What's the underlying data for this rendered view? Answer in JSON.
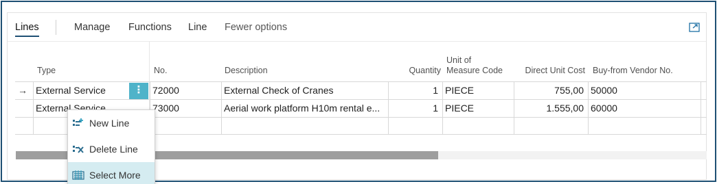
{
  "toolbar": {
    "lines": "Lines",
    "manage": "Manage",
    "functions": "Functions",
    "line": "Line",
    "fewer_options": "Fewer options",
    "expand_icon": "expand-icon"
  },
  "grid": {
    "headers": {
      "type": "Type",
      "no": "No.",
      "description": "Description",
      "quantity": "Quantity",
      "uom_line1": "Unit of",
      "uom_line2": "Measure Code",
      "direct_unit_cost": "Direct Unit Cost",
      "buy_from_vendor": "Buy-from Vendor No."
    },
    "rows": [
      {
        "type": "External Service",
        "no": "72000",
        "description": "External Check of Cranes",
        "quantity": "1",
        "uom": "PIECE",
        "cost": "755,00",
        "vendor": "50000"
      },
      {
        "type": "External Service",
        "no": "73000",
        "description": "Aerial work platform H10m rental e...",
        "quantity": "1",
        "uom": "PIECE",
        "cost": "1.555,00",
        "vendor": "60000"
      }
    ],
    "current_row_indicator": "→",
    "row_actions": "⋮"
  },
  "context_menu": {
    "items": [
      {
        "label": "New Line",
        "icon": "new-line-icon"
      },
      {
        "label": "Delete Line",
        "icon": "delete-line-icon"
      },
      {
        "label": "Select More",
        "icon": "select-more-icon"
      }
    ],
    "highlighted_index": 2
  },
  "colors": {
    "accent": "#1d4f73",
    "dots_button": "#4fb3c9",
    "menu_highlight": "#d5ecf1"
  }
}
